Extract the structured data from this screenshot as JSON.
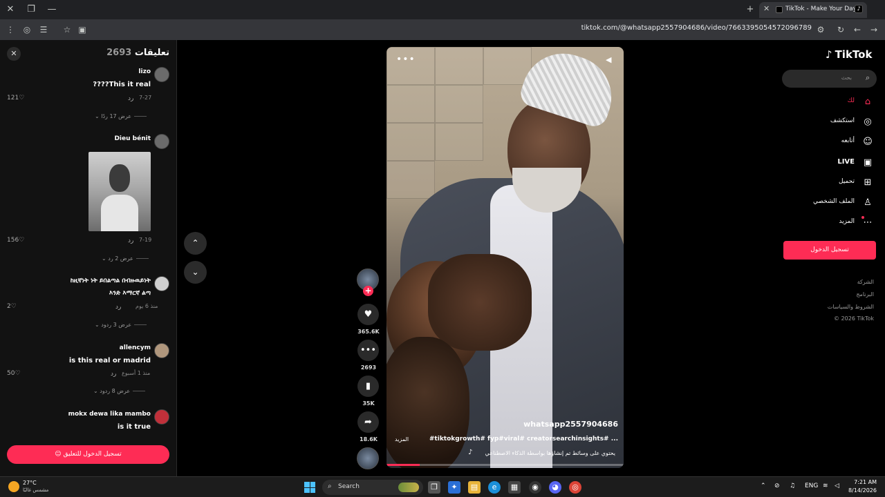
{
  "browser": {
    "tab_title": "TikTok - Make Your Day",
    "url": "tiktok.com/@whatsapp2557904686/video/7663395054572096789"
  },
  "comments": {
    "title": "تعليقات",
    "count": "2693",
    "items": [
      {
        "user": "lizo",
        "text": "????This it real",
        "date": "7-27",
        "reply": "رد",
        "likes": "121",
        "more": "عرض 17 ردًا"
      },
      {
        "user": "Dieu bénit",
        "text": "",
        "date": "7-19",
        "reply": "رد",
        "likes": "156",
        "more": "عرض 2 رد"
      },
      {
        "user": "",
        "text_line1": "ከዚኛነት ነት ይበልጣል በብዙዉይነት",
        "text_line2": "እንድ እማርኛ ልጣ",
        "date": "منذ 6 يوم",
        "reply": "رد",
        "likes": "2",
        "more": "عرض 3 ردود"
      },
      {
        "user": "allencym",
        "text": "is this real or madrid",
        "date": "منذ 1 أسبوع",
        "reply": "رد",
        "likes": "50",
        "more": "عرض 8 ردود"
      },
      {
        "user": "mokx dewa lika mambo",
        "text": "is it true"
      }
    ],
    "login_prompt": "تسجيل الدخول للتعليق"
  },
  "video": {
    "author": "whatsapp2557904686",
    "description": "#tiktokgrowth# fyp#viral# creatorsearchinsights# ...",
    "more": "المزيد",
    "ai_label": "يحتوي على وسائط تم إنشاؤها بواسطة الذكاء الاصطناعي",
    "progress": 0.14
  },
  "actions": {
    "likes": "365.6K",
    "comments": "2693",
    "saves": "35K",
    "shares": "18.6K"
  },
  "sidebar": {
    "logo": "TikTok",
    "search_placeholder": "بحث",
    "nav": [
      {
        "label": "لك",
        "icon": "home-icon",
        "active": true
      },
      {
        "label": "استكشف",
        "icon": "compass-icon"
      },
      {
        "label": "أتابعه",
        "icon": "following-icon"
      },
      {
        "label": "LIVE",
        "icon": "live-icon"
      },
      {
        "label": "تحميل",
        "icon": "upload-icon"
      },
      {
        "label": "الملف الشخصي",
        "icon": "profile-icon"
      },
      {
        "label": "المزيد",
        "icon": "more-icon"
      }
    ],
    "login_button": "تسجيل الدخول",
    "footer": [
      "الشركة",
      "البرنامج",
      "الشروط والسياسات",
      "© 2026 TikTok"
    ]
  },
  "taskbar": {
    "temperature": "27°C",
    "weather": "مشمس غالبًا",
    "search": "Search",
    "language": "ENG",
    "time": "7:21 AM",
    "date": "8/14/2026"
  },
  "colors": {
    "accent": "#fe2c55",
    "background": "#000000",
    "panel": "#121212"
  }
}
